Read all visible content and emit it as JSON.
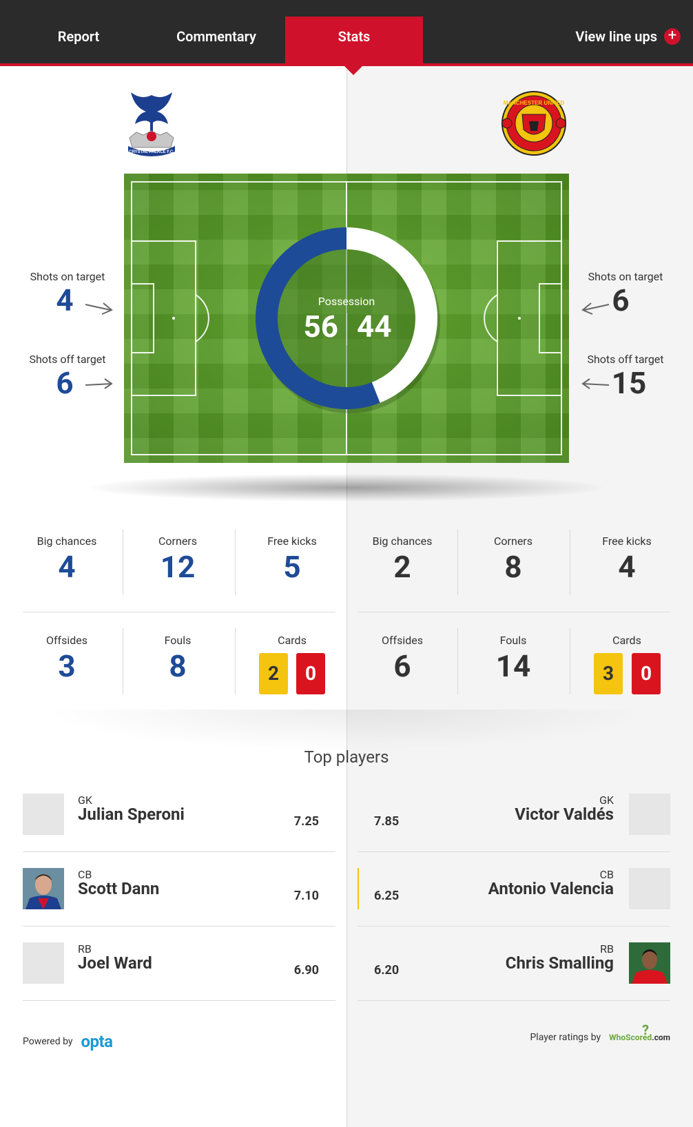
{
  "nav": {
    "tabs": [
      {
        "label": "Report"
      },
      {
        "label": "Commentary"
      },
      {
        "label": "Stats"
      }
    ],
    "lineups_label": "View line ups"
  },
  "colors": {
    "accent_red": "#d0112b",
    "home_blue": "#1e4b97",
    "away_white": "#ffffff",
    "yellow_card": "#f4c40e",
    "red_card": "#d9141f"
  },
  "home_team": {
    "crest_text": "CRYSTAL PALACE F.C.",
    "shots_on_target_label": "Shots on target",
    "shots_on_target": "4",
    "shots_off_target_label": "Shots off target",
    "shots_off_target": "6",
    "possession": "56",
    "stats": {
      "big_chances_label": "Big chances",
      "big_chances": "4",
      "corners_label": "Corners",
      "corners": "12",
      "free_kicks_label": "Free kicks",
      "free_kicks": "5",
      "offsides_label": "Offsides",
      "offsides": "3",
      "fouls_label": "Fouls",
      "fouls": "8",
      "cards_label": "Cards",
      "yellow": "2",
      "red": "0"
    },
    "players": [
      {
        "position": "GK",
        "name": "Julian Speroni",
        "rating": "7.25"
      },
      {
        "position": "CB",
        "name": "Scott Dann",
        "rating": "7.10"
      },
      {
        "position": "RB",
        "name": "Joel Ward",
        "rating": "6.90"
      }
    ]
  },
  "away_team": {
    "crest_text": "MANCHESTER UNITED",
    "shots_on_target_label": "Shots on target",
    "shots_on_target": "6",
    "shots_off_target_label": "Shots off target",
    "shots_off_target": "15",
    "possession": "44",
    "stats": {
      "big_chances_label": "Big chances",
      "big_chances": "2",
      "corners_label": "Corners",
      "corners": "8",
      "free_kicks_label": "Free kicks",
      "free_kicks": "4",
      "offsides_label": "Offsides",
      "offsides": "6",
      "fouls_label": "Fouls",
      "fouls": "14",
      "cards_label": "Cards",
      "yellow": "3",
      "red": "0"
    },
    "players": [
      {
        "position": "GK",
        "name": "Victor Valdés",
        "rating": "7.85"
      },
      {
        "position": "CB",
        "name": "Antonio Valencia",
        "rating": "6.25"
      },
      {
        "position": "RB",
        "name": "Chris Smalling",
        "rating": "6.20"
      }
    ]
  },
  "possession_label": "Possession",
  "top_players_title": "Top players",
  "footer": {
    "powered_by": "Powered by",
    "opta_logo": "opta",
    "ratings_by": "Player ratings by",
    "whoscored_logo_a": "WhoScored",
    "whoscored_logo_b": ".com"
  }
}
